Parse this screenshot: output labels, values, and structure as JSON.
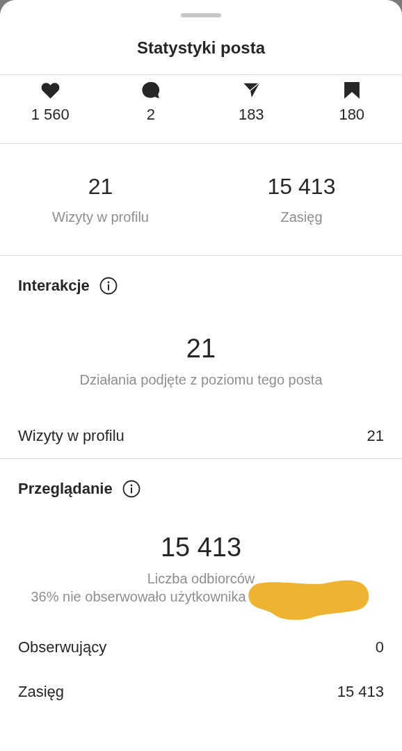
{
  "sheet": {
    "title": "Statystyki posta"
  },
  "counts": [
    {
      "kind": "likes",
      "value": "1 560"
    },
    {
      "kind": "comments",
      "value": "2"
    },
    {
      "kind": "shares",
      "value": "183"
    },
    {
      "kind": "saves",
      "value": "180"
    }
  ],
  "summary": [
    {
      "value": "21",
      "label": "Wizyty w profilu"
    },
    {
      "value": "15 413",
      "label": "Zasięg"
    }
  ],
  "sections": [
    {
      "title": "Interakcje",
      "big": "21",
      "captions": [
        "Działania podjęte z poziomu tego posta"
      ],
      "redacted": false,
      "rows": [
        {
          "label": "Wizyty w profilu",
          "value": "21"
        }
      ]
    },
    {
      "title": "Przeglądanie",
      "big": "15 413",
      "captions": [
        "Liczba odbiorców",
        "36% nie obserwowało użytkownika"
      ],
      "redacted": true,
      "rows": [
        {
          "label": "Obserwujący",
          "value": "0"
        },
        {
          "label": "Zasięg",
          "value": "15 413"
        }
      ]
    }
  ]
}
